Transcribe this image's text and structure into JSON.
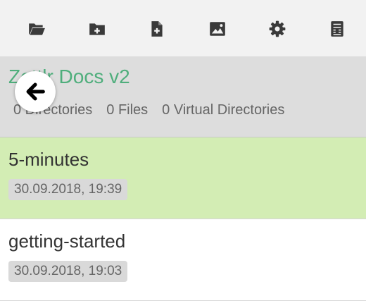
{
  "colors": {
    "accent_green": "#4fae7c",
    "active_row": "#d3edb4",
    "toolbar_bg": "#f2f2f2",
    "header_bg": "#dddddd",
    "icon": "#3a3a3a"
  },
  "toolbar": {
    "buttons": [
      {
        "icon": "folder-open-icon"
      },
      {
        "icon": "new-folder-icon"
      },
      {
        "icon": "new-file-icon"
      },
      {
        "icon": "image-icon"
      },
      {
        "icon": "gear-icon"
      },
      {
        "icon": "calculator-icon"
      }
    ]
  },
  "folder": {
    "title": "Zettlr Docs v2",
    "stats": {
      "directories": "0 Directories",
      "files": "0 Files",
      "virtual_directories": "0 Virtual Directories"
    }
  },
  "back_button": {
    "icon": "arrow-left-icon"
  },
  "files": [
    {
      "name": "5-minutes",
      "date": "30.09.2018, 19:39",
      "active": true
    },
    {
      "name": "getting-started",
      "date": "30.09.2018, 19:03",
      "active": false
    }
  ]
}
